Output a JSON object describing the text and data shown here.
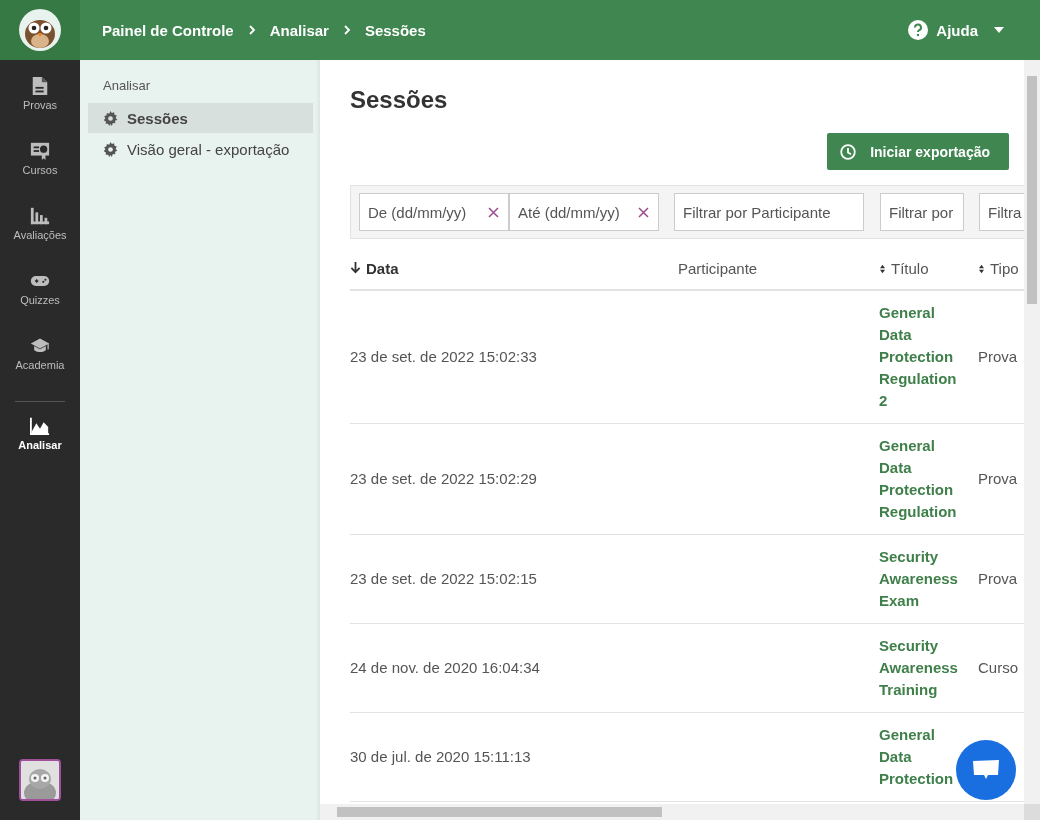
{
  "header": {
    "breadcrumbs": [
      "Painel de Controle",
      "Analisar",
      "Sessões"
    ],
    "help": "Ajuda"
  },
  "rail": {
    "items": [
      {
        "label": "Provas",
        "kind": "document",
        "selected": false
      },
      {
        "label": "Cursos",
        "kind": "certificate",
        "selected": false
      },
      {
        "label": "Avaliações",
        "kind": "bars",
        "selected": false
      },
      {
        "label": "Quizzes",
        "kind": "gamepad",
        "selected": false
      },
      {
        "label": "Academia",
        "kind": "cap",
        "selected": false
      },
      {
        "label": "Analisar",
        "kind": "chart",
        "selected": true
      }
    ]
  },
  "subnav": {
    "title": "Analisar",
    "items": [
      {
        "label": "Sessões",
        "selected": true
      },
      {
        "label": "Visão geral - exportação",
        "selected": false
      }
    ]
  },
  "page": {
    "title": "Sessões",
    "export_button": "Iniciar exportação"
  },
  "filters": [
    {
      "placeholder": "De (dd/mm/yy)",
      "clearable": true
    },
    {
      "placeholder": "Até (dd/mm/yy)",
      "clearable": true
    },
    {
      "placeholder": "Filtrar por Participante",
      "clearable": false
    },
    {
      "placeholder": "Filtrar por",
      "clearable": false
    },
    {
      "placeholder": "Filtra",
      "clearable": false
    }
  ],
  "table": {
    "columns": [
      {
        "label": "Data",
        "sorted": true,
        "sortable": true
      },
      {
        "label": "Participante",
        "sorted": false,
        "sortable": false
      },
      {
        "label": "Título",
        "sorted": false,
        "sortable": true
      },
      {
        "label": "Tipo",
        "sorted": false,
        "sortable": true
      }
    ],
    "rows": [
      {
        "date": "23 de set. de 2022 15:02:33",
        "title": "General Data Protection Regulation 2",
        "type": "Prova"
      },
      {
        "date": "23 de set. de 2022 15:02:29",
        "title": "General Data Protection Regulation",
        "type": "Prova"
      },
      {
        "date": "23 de set. de 2022 15:02:15",
        "title": "Security Awareness Exam",
        "type": "Prova"
      },
      {
        "date": "24 de nov. de 2020 16:04:34",
        "title": "Security Awareness Training",
        "type": "Curso"
      },
      {
        "date": "30 de jul. de 2020 15:11:13",
        "title": "General Data Protection"
      }
    ]
  }
}
